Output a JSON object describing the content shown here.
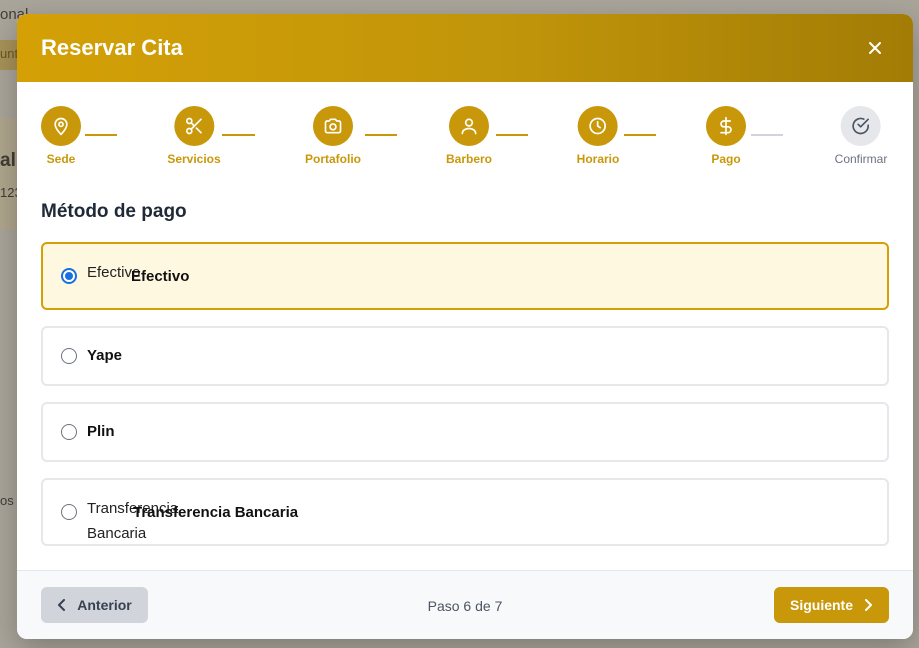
{
  "background": {
    "fragments": [
      "onal",
      "unt",
      "al",
      "123",
      "os"
    ]
  },
  "modal": {
    "title": "Reservar Cita",
    "close_icon": "close-icon"
  },
  "stepper": {
    "steps": [
      {
        "label": "Sede",
        "icon": "map-pin-icon",
        "status": "done"
      },
      {
        "label": "Servicios",
        "icon": "scissors-icon",
        "status": "done"
      },
      {
        "label": "Portafolio",
        "icon": "camera-icon",
        "status": "done"
      },
      {
        "label": "Barbero",
        "icon": "user-icon",
        "status": "done"
      },
      {
        "label": "Horario",
        "icon": "clock-icon",
        "status": "done"
      },
      {
        "label": "Pago",
        "icon": "dollar-icon",
        "status": "current"
      },
      {
        "label": "Confirmar",
        "icon": "check-circle-icon",
        "status": "pending"
      }
    ]
  },
  "payment": {
    "title": "Método de pago",
    "options": [
      {
        "native": "Efectivo",
        "label": "Efectivo",
        "selected": true
      },
      {
        "native": "",
        "label": "Yape",
        "selected": false
      },
      {
        "native": "",
        "label": "Plin",
        "selected": false
      },
      {
        "native_line1": "Transferencia",
        "native_line2": "Bancaria",
        "label": "Transferencia Bancaria",
        "selected": false
      }
    ]
  },
  "footer": {
    "prev_label": "Anterior",
    "step_counter": "Paso 6 de 7",
    "next_label": "Siguiente"
  },
  "colors": {
    "accent": "#c9980a",
    "radio_selected": "#1a6fe0",
    "selected_bg": "#fff8e1"
  }
}
